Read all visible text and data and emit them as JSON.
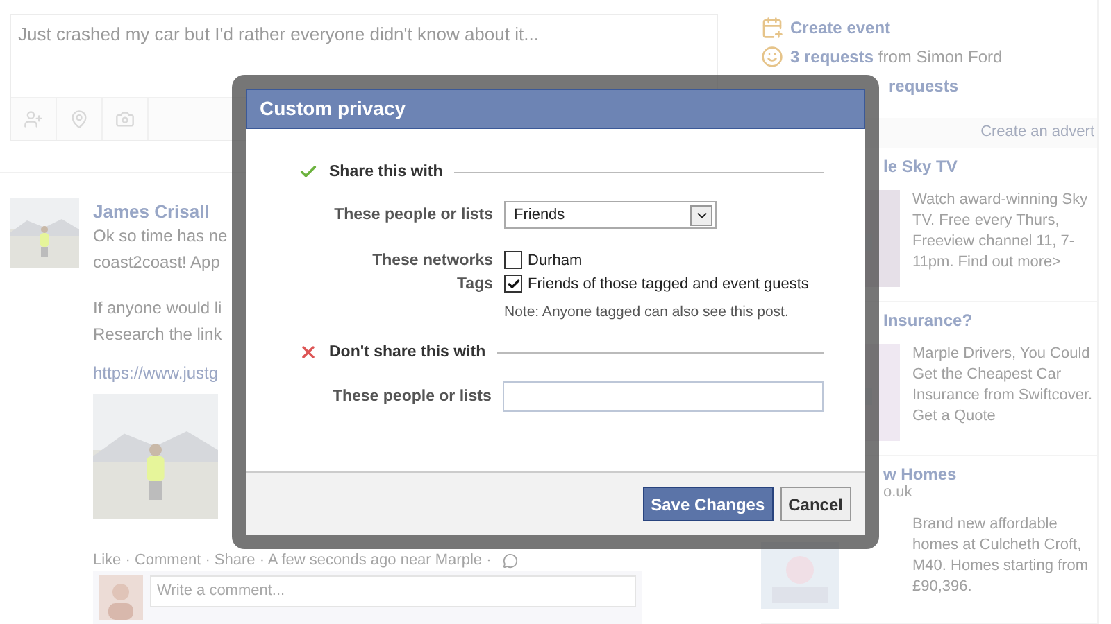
{
  "composer": {
    "placeholder": "Just crashed my car but I'd rather everyone didn't know about it..."
  },
  "post": {
    "author": "James Crisall",
    "paragraphs": [
      [
        "Ok so time has ne",
        "coast2coast! App"
      ],
      [
        "If anyone would li",
        "Research the link"
      ]
    ],
    "link": "https://www.justg",
    "actions": "Like · Comment · Share · A few seconds ago near Marple ·",
    "comment_placeholder": "Write a comment..."
  },
  "sidebar": {
    "links": [
      {
        "kind": "event",
        "text": "**Create event**"
      },
      {
        "kind": "requests",
        "text": "**3 requests** from Simon Ford"
      },
      {
        "kind": "apps",
        "text": "**requests**"
      }
    ],
    "advert_link": "Create an advert",
    "ads": [
      {
        "title": "le Sky TV",
        "body": "Watch award-winning Sky TV. Free every Thurs, Freeview channel 11, 7-11pm. Find out more>"
      },
      {
        "title": "Insurance?",
        "body": "Marple Drivers, You Could Get the Cheapest Car Insurance from Swiftcover. Get a Quote"
      },
      {
        "title": "w Homes",
        "domain": "o.uk",
        "body": "Brand new affordable homes at Culcheth Croft, M40. Homes starting from £90,396."
      }
    ]
  },
  "dialog": {
    "title": "Custom privacy",
    "sections": [
      {
        "kind": "share",
        "heading": "Share this with",
        "rows": [
          {
            "kind": "select",
            "label": "These people or lists",
            "value": "Friends"
          },
          {
            "kind": "checkbox",
            "label": "These networks",
            "option": "Durham",
            "checked": false
          },
          {
            "kind": "checkbox",
            "label": "Tags",
            "option": "Friends of those tagged and event guests",
            "checked": true
          },
          {
            "kind": "note",
            "text": "Note: Anyone tagged can also see this post."
          }
        ]
      },
      {
        "kind": "exclude",
        "heading": "Don't share this with",
        "rows": [
          {
            "kind": "input",
            "label": "These people or lists"
          }
        ]
      }
    ],
    "buttons": [
      {
        "kind": "primary",
        "label": "Save Changes"
      },
      {
        "kind": "secondary",
        "label": "Cancel"
      }
    ]
  }
}
